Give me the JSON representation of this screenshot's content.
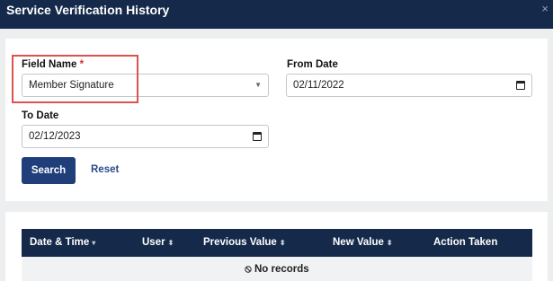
{
  "window": {
    "title": "Service Verification History",
    "close": "×"
  },
  "filters": {
    "field_name": {
      "label": "Field Name",
      "required_mark": "*",
      "value": "Member Signature"
    },
    "from_date": {
      "label": "From Date",
      "value": "02/11/2022"
    },
    "to_date": {
      "label": "To Date",
      "value": "02/12/2023"
    },
    "search_label": "Search",
    "reset_label": "Reset"
  },
  "table": {
    "columns": [
      {
        "label": "Date & Time",
        "sort": "▾"
      },
      {
        "label": "User",
        "sort": "⬍"
      },
      {
        "label": "Previous Value",
        "sort": "⬍"
      },
      {
        "label": "New Value",
        "sort": "⬍"
      },
      {
        "label": "Action Taken",
        "sort": ""
      }
    ],
    "empty_icon": "⦸",
    "empty_text": "No records"
  }
}
